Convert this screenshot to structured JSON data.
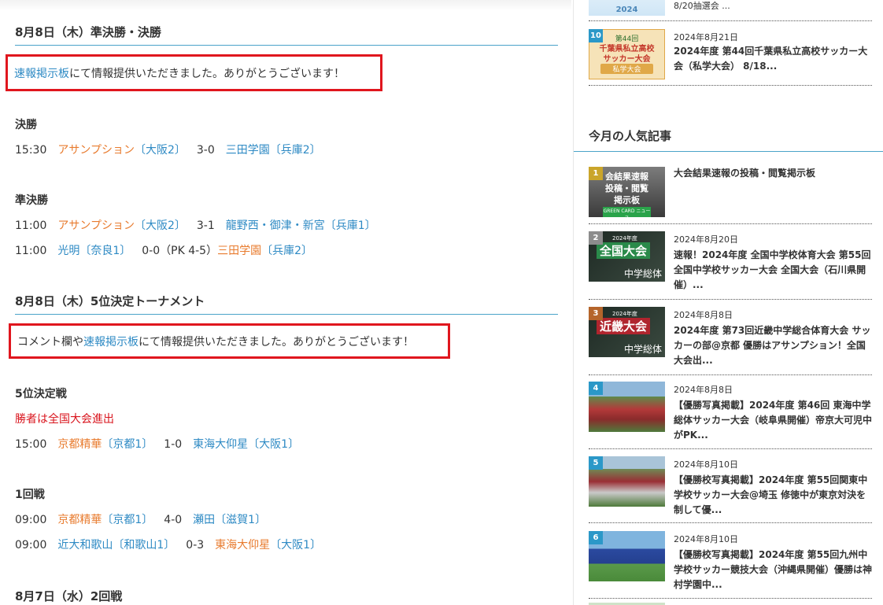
{
  "main": {
    "section1_title": "8月8日（木）準決勝・決勝",
    "notice1": {
      "link": "速報掲示板",
      "text": "にて情報提供いただきました。ありがとうございます！"
    },
    "final_title": "決勝",
    "final": [
      {
        "time": "15:30",
        "home": "アサンプション",
        "home_pref": "〔大阪2〕",
        "score": "3-0",
        "away": "三田学園",
        "away_pref": "〔兵庫2〕"
      }
    ],
    "semi_title": "準決勝",
    "semi": [
      {
        "time": "11:00",
        "home": "アサンプション",
        "home_pref": "〔大阪2〕",
        "score": "3-1",
        "away": "龍野西・御津・新宮",
        "away_pref": "〔兵庫1〕"
      },
      {
        "time": "11:00",
        "home": "光明",
        "home_pref": "〔奈良1〕",
        "score": "0-0（PK 4-5）",
        "away": "三田学園",
        "away_pref": "〔兵庫2〕"
      }
    ],
    "section2_title": "8月8日（木）5位決定トーナメント",
    "notice2": {
      "prefix": "コメント欄や",
      "link": "速報掲示板",
      "text": "にて情報提供いただきました。ありがとうございます！"
    },
    "fifth_title": "5位決定戦",
    "fifth_note": "勝者は全国大会進出",
    "fifth": [
      {
        "time": "15:00",
        "home": "京都精華",
        "home_pref": "〔京都1〕",
        "score": "1-0",
        "away": "東海大仰星",
        "away_pref": "〔大阪1〕"
      }
    ],
    "round1_title": "1回戦",
    "round1": [
      {
        "time": "09:00",
        "home": "京都精華",
        "home_pref": "〔京都1〕",
        "score": "4-0",
        "away": "瀬田",
        "away_pref": "〔滋賀1〕"
      },
      {
        "time": "09:00",
        "home": "近大和歌山",
        "home_pref": "〔和歌山1〕",
        "score": "0-3",
        "away": "東海大仰星",
        "away_pref": "〔大阪1〕"
      }
    ],
    "section3_title": "8月7日（水）2回戦"
  },
  "sidebar": {
    "top_partial": {
      "title": "8/20抽選会 ...",
      "thumb_text": "2024"
    },
    "top_post": {
      "rank": "10",
      "date": "2024年8月21日",
      "title": "2024年度 第44回千葉県私立高校サッカー大会（私学大会） 8/18...",
      "thumb_lines": [
        "第44回",
        "千葉県私立高校",
        "サッカー大会",
        "私学大会"
      ]
    },
    "popular_title": "今月の人気記事",
    "popular": [
      {
        "rank": "1",
        "date": "",
        "title": "大会結果速報の投稿・閲覧掲示板",
        "thumb_lines": [
          "会結果速報",
          "投稿・閲覧",
          "掲示板",
          "GREEN CARD ニュース"
        ]
      },
      {
        "rank": "2",
        "date": "2024年8月20日",
        "title": "速報！2024年度 全国中学校体育大会 第55回全国中学校サッカー大会 全国大会（石川県開催）...",
        "thumb_lines": [
          "2024年度",
          "全国大会",
          "中学総体"
        ]
      },
      {
        "rank": "3",
        "date": "2024年8月8日",
        "title": "2024年度 第73回近畿中学総合体育大会 サッカーの部@京都 優勝はアサンプション！全国大会出...",
        "thumb_lines": [
          "2024年度",
          "近畿大会",
          "中学総体"
        ]
      },
      {
        "rank": "4",
        "date": "2024年8月8日",
        "title": "【優勝写真掲載】2024年度 第46回 東海中学総体サッカー大会（岐阜県開催）帝京大可児中がPK...",
        "thumb_lines": []
      },
      {
        "rank": "5",
        "date": "2024年8月10日",
        "title": "【優勝校写真掲載】2024年度 第55回関東中学校サッカー大会@埼玉 修徳中が東京対決を制して優...",
        "thumb_lines": []
      },
      {
        "rank": "6",
        "date": "2024年8月10日",
        "title": "【優勝校写真掲載】2024年度 第55回九州中学校サッカー競技大会（沖縄県開催）優勝は神村学園中...",
        "thumb_lines": []
      }
    ]
  },
  "colors": {
    "link": "#2e8ac4",
    "orange": "#e87b2e",
    "red": "#d9141d",
    "accent_line": "#4aa3c9",
    "highlight_box": "#e0161e"
  }
}
